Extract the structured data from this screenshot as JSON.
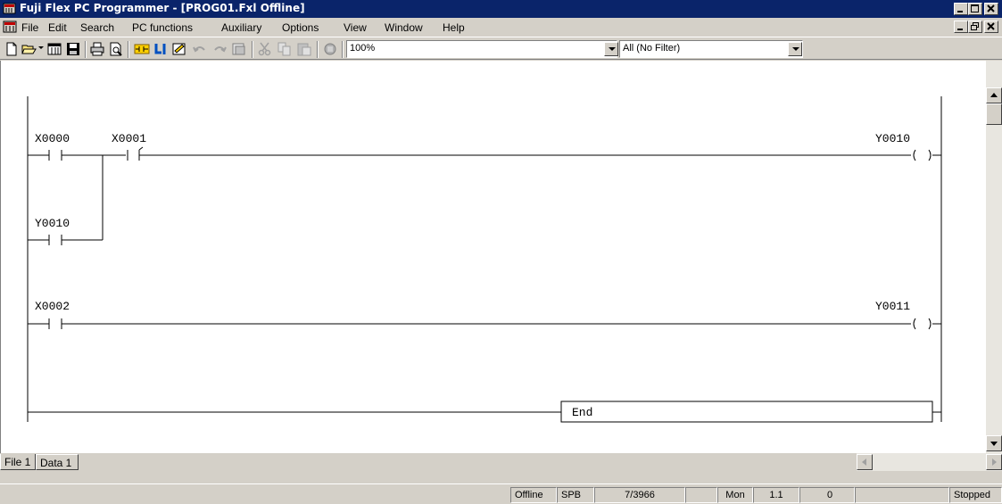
{
  "window": {
    "title": "Fuji Flex PC Programmer - [PROG01.Fxl Offline]"
  },
  "menu": {
    "items": [
      {
        "label": "File"
      },
      {
        "label": "Edit"
      },
      {
        "label": "Search"
      },
      {
        "label": "PC functions"
      },
      {
        "label": "Auxiliary"
      },
      {
        "label": "Options"
      },
      {
        "label": "View"
      },
      {
        "label": "Window"
      },
      {
        "label": "Help"
      }
    ]
  },
  "toolbar": {
    "zoom": "100%",
    "filter": "All (No Filter)",
    "icons": [
      "new-file-icon",
      "open-folder-icon",
      "dropdown-arrow-icon",
      "pc-icon",
      "save-icon",
      "print-icon",
      "print-preview-icon",
      "contact-icon",
      "coil-icon",
      "edit-icon",
      "undo-icon",
      "redo-icon",
      "transfer-icon",
      "cut-icon",
      "copy-icon",
      "paste-icon",
      "monitor-icon"
    ]
  },
  "ladder": {
    "rung1": {
      "contacts": [
        "X0000",
        "X0001"
      ],
      "branch_contact": "Y0010",
      "coil": "Y0010"
    },
    "rung2": {
      "contacts": [
        "X0002"
      ],
      "coil": "Y0011"
    },
    "end_label": "End"
  },
  "tabs": [
    {
      "label": "File 1"
    },
    {
      "label": "Data 1"
    }
  ],
  "status": {
    "mode": "Offline",
    "type": "SPB",
    "steps": "7/3966",
    "blank1": "",
    "day": "Mon",
    "version": "1.1",
    "count": "0",
    "blank2": "",
    "state": "Stopped"
  }
}
